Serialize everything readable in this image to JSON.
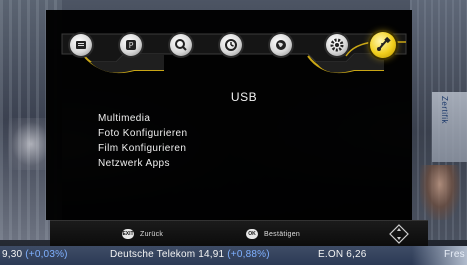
{
  "background": {
    "side_text": "Zertifik"
  },
  "top_menu": {
    "icons": [
      {
        "name": "tv-guide-icon",
        "active": false
      },
      {
        "name": "picture-icon",
        "active": false
      },
      {
        "name": "search-icon",
        "active": false
      },
      {
        "name": "clock-icon",
        "active": false
      },
      {
        "name": "globe-icon",
        "active": false
      },
      {
        "name": "gear-icon",
        "active": false
      },
      {
        "name": "usb-icon",
        "active": true
      }
    ],
    "accent_color": "#f1cf1d"
  },
  "section": {
    "title": "USB",
    "items": [
      "Multimedia",
      "Foto Konfigurieren",
      "Film Konfigurieren",
      "Netzwerk Apps"
    ]
  },
  "help_bar": {
    "back": {
      "key": "EXIT",
      "label": "Zurück"
    },
    "confirm": {
      "key": "OK",
      "label": "Bestätigen"
    },
    "nav_icon": "navigation-diamond-icon"
  },
  "ticker": {
    "items": [
      {
        "value": "9,30",
        "change": "(+0,03%)"
      },
      {
        "name": "Deutsche Telekom",
        "value": "14,91",
        "change": "(+0,88%)"
      },
      {
        "name": "E.ON",
        "value": "6,26",
        "change": ""
      }
    ],
    "tail": "Fres"
  }
}
